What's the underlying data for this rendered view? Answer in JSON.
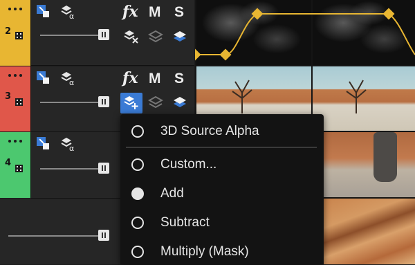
{
  "tracks": [
    {
      "number": "2",
      "color": "#e8b632"
    },
    {
      "number": "3",
      "color": "#e0574a"
    },
    {
      "number": "4",
      "color": "#4cc86f"
    }
  ],
  "track_controls": {
    "fx_label": "fx",
    "mute_label": "M",
    "solo_label": "S"
  },
  "keyframe_color": "#e8b632",
  "blend_menu": {
    "items": [
      {
        "label": "3D Source Alpha",
        "selected": false
      },
      {
        "label": "Custom...",
        "selected": false
      },
      {
        "label": "Add",
        "selected": true
      },
      {
        "label": "Subtract",
        "selected": false
      },
      {
        "label": "Multiply (Mask)",
        "selected": false
      }
    ]
  }
}
